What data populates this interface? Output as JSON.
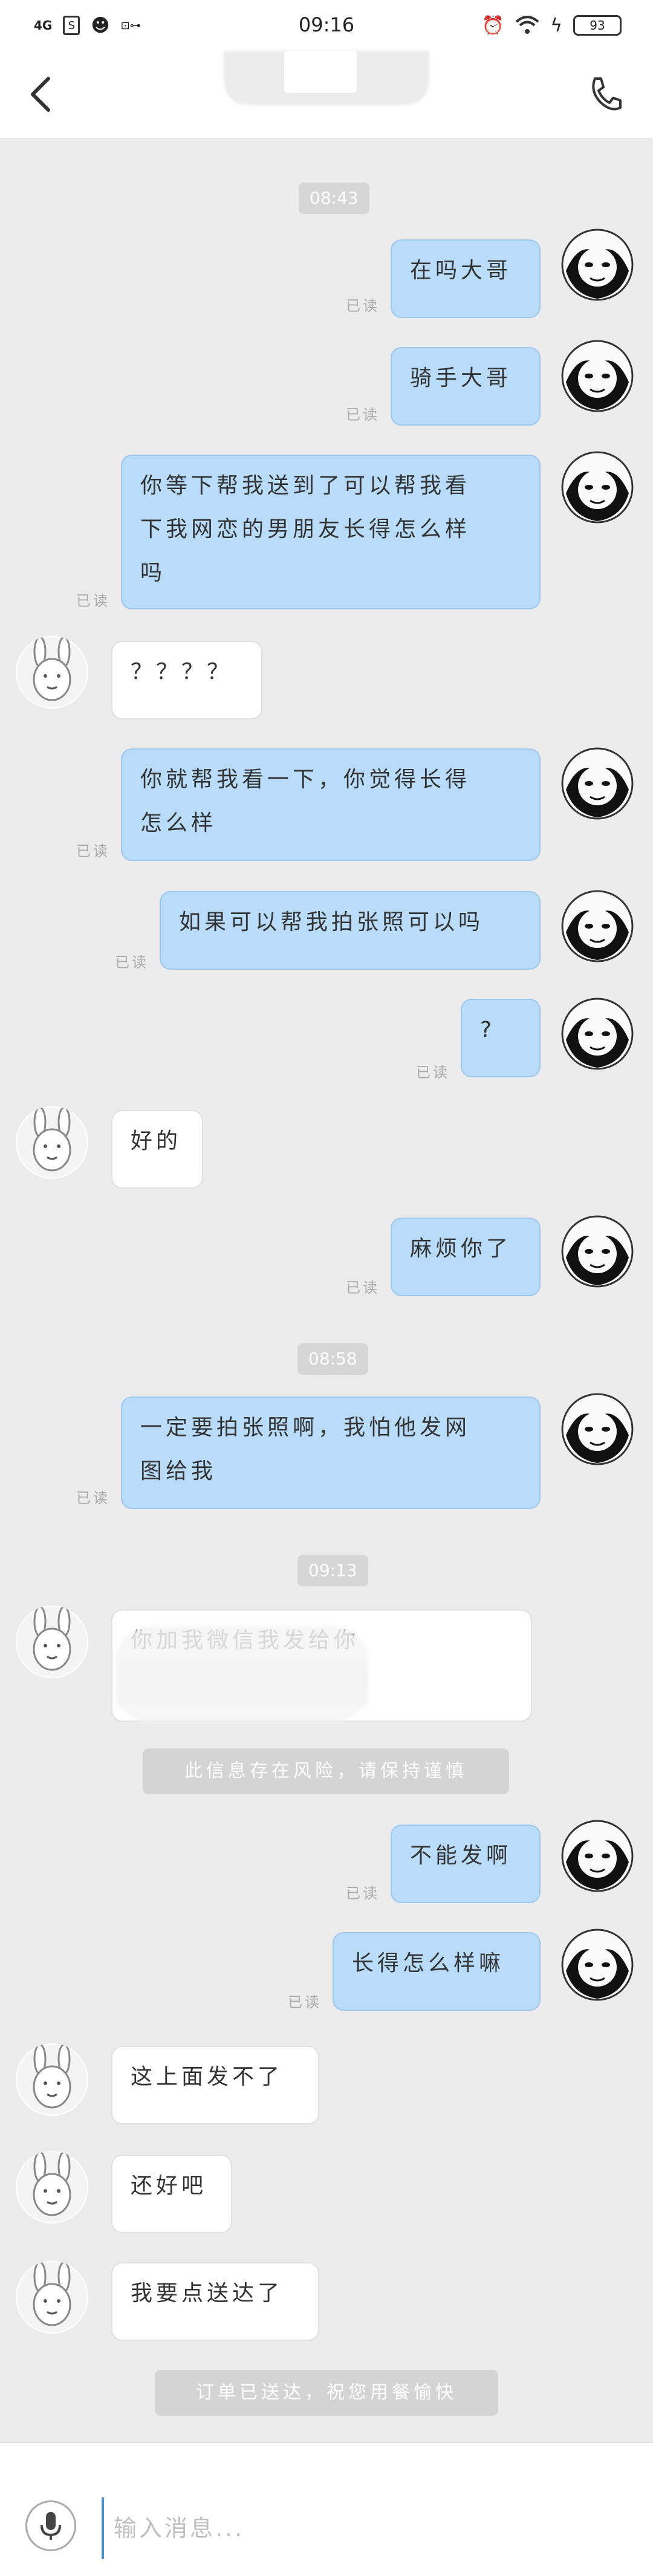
{
  "status_bar": {
    "network": "4G",
    "sim_icon": "sim-icon",
    "qq_icon": "qq-icon",
    "time": "09:16",
    "battery": "93"
  },
  "header": {
    "back_icon": "chevron-left-icon",
    "call_icon": "phone-icon"
  },
  "messages": {
    "t1": "08:43",
    "m1": "在吗大哥",
    "m2": "骑手大哥",
    "m3_l1": "你等下帮我送到了可以帮我看",
    "m3_l2": "下我网恋的男朋友长得怎么样",
    "m3_l3": "吗",
    "r1": "？？？？",
    "m4_l1": "你就帮我看一下，你觉得长得",
    "m4_l2": "怎么样",
    "m5": "如果可以帮我拍张照可以吗",
    "m6": "?",
    "r2": "好的",
    "m7": "麻烦你了",
    "t2": "08:58",
    "m8_l1": "一定要拍张照啊，我怕他发网",
    "m8_l2": "图给我",
    "t3": "09:13",
    "r3": "你加我微信我发给你",
    "risk": "此信息存在风险，请保持谨慎",
    "m9": "不能发啊",
    "m10": "长得怎么样嘛",
    "r4": "这上面发不了",
    "r5": "还好吧",
    "r6": "我要点送达了",
    "delivered": "订单已送达，祝您用餐愉快"
  },
  "read_label": "已读",
  "input": {
    "placeholder": "输入消息...",
    "value": ""
  },
  "colors": {
    "my_bubble": "#b9dcfb",
    "their_bubble": "#ffffff",
    "background": "#ececec"
  }
}
